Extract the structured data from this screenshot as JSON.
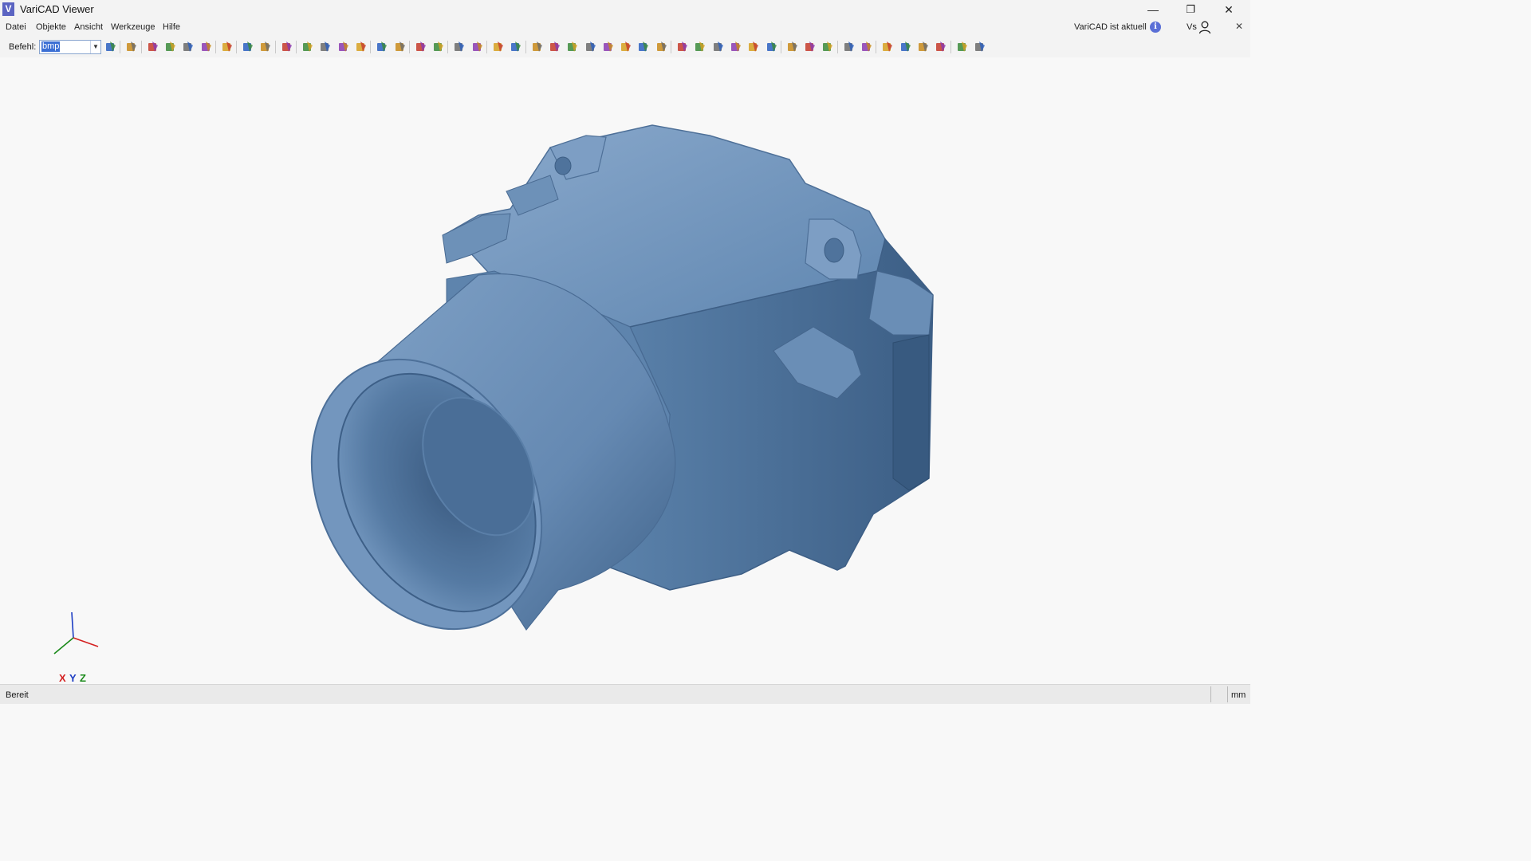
{
  "window": {
    "title": "VariCAD Viewer",
    "logo_letter": "V",
    "minimize_glyph": "—",
    "restore_glyph": "❐",
    "close_glyph": "✕"
  },
  "menu": {
    "items": [
      "Datei",
      "Objekte",
      "Ansicht",
      "Werkzeuge",
      "Hilfe"
    ],
    "update_status": "VariCAD ist aktuell",
    "user": "Vs"
  },
  "toolbar": {
    "command_label": "Befehl:",
    "command_value": "bmp",
    "buttons": [
      "export-icon",
      "home-icon",
      "open-folder-icon",
      "save-icon",
      "save-as-icon",
      "save-all-icon",
      "print-icon",
      "undo-icon",
      "redo-icon",
      "layers-icon",
      "query-v-icon",
      "query-s-icon",
      "query-s2-icon",
      "query-j-icon",
      "explode-icon",
      "assembly-icon",
      "box-wire-icon",
      "box-solid-icon",
      "axis-xyz-icon",
      "axis-rotate-icon",
      "solid-box-icon",
      "solid-tools-icon",
      "measure-1-icon",
      "measure-2-icon",
      "measure-3-icon",
      "measure-4-icon",
      "measure-5-icon",
      "measure-6-icon",
      "measure-7-icon",
      "measure-8-icon",
      "clip-1-icon",
      "clip-2-icon",
      "display-1-icon",
      "display-2-icon",
      "display-3-icon",
      "display-4-icon",
      "zoom-window-icon",
      "zoom-all-icon",
      "shade-icon",
      "zoom-in-icon",
      "zoom-out-icon",
      "pan-left-icon",
      "pan-right-icon",
      "view-up-icon",
      "view-down-icon",
      "mode-2d-icon",
      "mode-3d-icon"
    ]
  },
  "viewport": {
    "axes": {
      "x": "X",
      "y": "Y",
      "z": "Z"
    },
    "model_color": "#6f95bd",
    "axis_colors": {
      "x": "#d42020",
      "y": "#1f3fc4",
      "z": "#1a8a1a"
    }
  },
  "status": {
    "text": "Bereit",
    "unit": "mm"
  }
}
